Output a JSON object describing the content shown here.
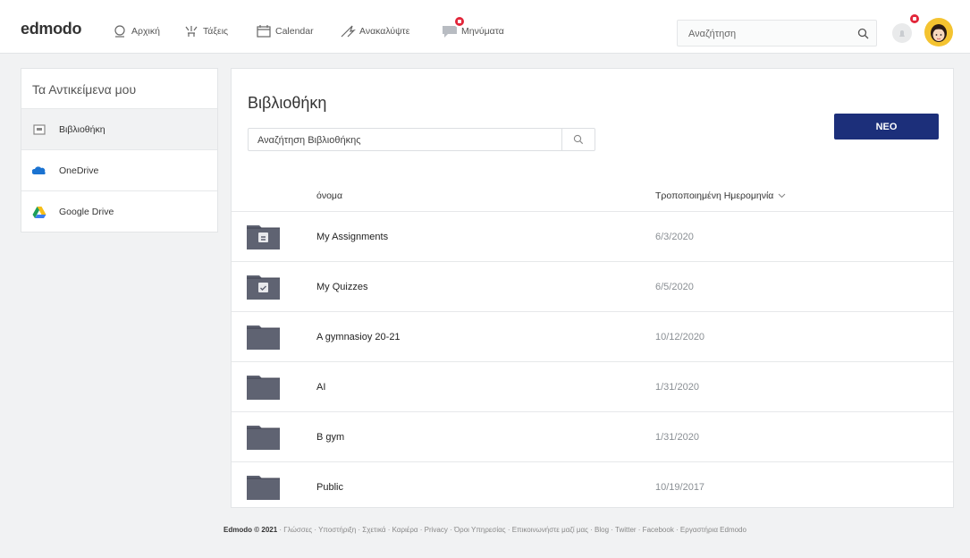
{
  "header": {
    "logo": "edmodo",
    "nav": [
      {
        "label": "Αρχική",
        "icon": "home-icon"
      },
      {
        "label": "Τάξεις",
        "icon": "classes-icon"
      },
      {
        "label": "Calendar",
        "icon": "calendar-icon"
      },
      {
        "label": "Ανακαλύψτε",
        "icon": "discover-icon"
      },
      {
        "label": "Μηνύματα",
        "icon": "messages-icon"
      }
    ],
    "search_placeholder": "Αναζήτηση",
    "notification_icon": "bell-icon",
    "avatar_icon": "avatar"
  },
  "sidebar": {
    "title": "Τα Αντικείμενα μου",
    "items": [
      {
        "label": "Βιβλιοθήκη",
        "icon": "library-icon",
        "active": true
      },
      {
        "label": "OneDrive",
        "icon": "onedrive-icon"
      },
      {
        "label": "Google Drive",
        "icon": "google-drive-icon"
      }
    ]
  },
  "library": {
    "title": "Βιβλιοθήκη",
    "search_placeholder": "Αναζήτηση Βιβλιοθήκης",
    "new_button": "ΝΕΟ",
    "columns": {
      "name": "όνομα",
      "modified": "Τροποποιημένη Ημερομηνία"
    },
    "rows": [
      {
        "name": "My Assignments",
        "date": "6/3/2020",
        "icon": "assignments-folder-icon"
      },
      {
        "name": "My Quizzes",
        "date": "6/5/2020",
        "icon": "quizzes-folder-icon"
      },
      {
        "name": "A gymnasioy 20-21",
        "date": "10/12/2020",
        "icon": "folder-icon"
      },
      {
        "name": "AI",
        "date": "1/31/2020",
        "icon": "folder-icon"
      },
      {
        "name": "B gym",
        "date": "1/31/2020",
        "icon": "folder-icon"
      },
      {
        "name": "Public",
        "date": "10/19/2017",
        "icon": "folder-icon"
      }
    ]
  },
  "footer": {
    "brand": "Edmodo © 2021",
    "links": "· Γλώσσες · Υποστήριξη · Σχετικά · Καριέρα · Privacy · Όροι Υπηρεσίας · Επικοινωνήστε μαζί μας · Blog · Twitter · Facebook · Εργαστήρια Edmodo"
  },
  "colors": {
    "accent": "#1c2f7a",
    "badge": "#e2263a",
    "folder": "#5f6372"
  }
}
